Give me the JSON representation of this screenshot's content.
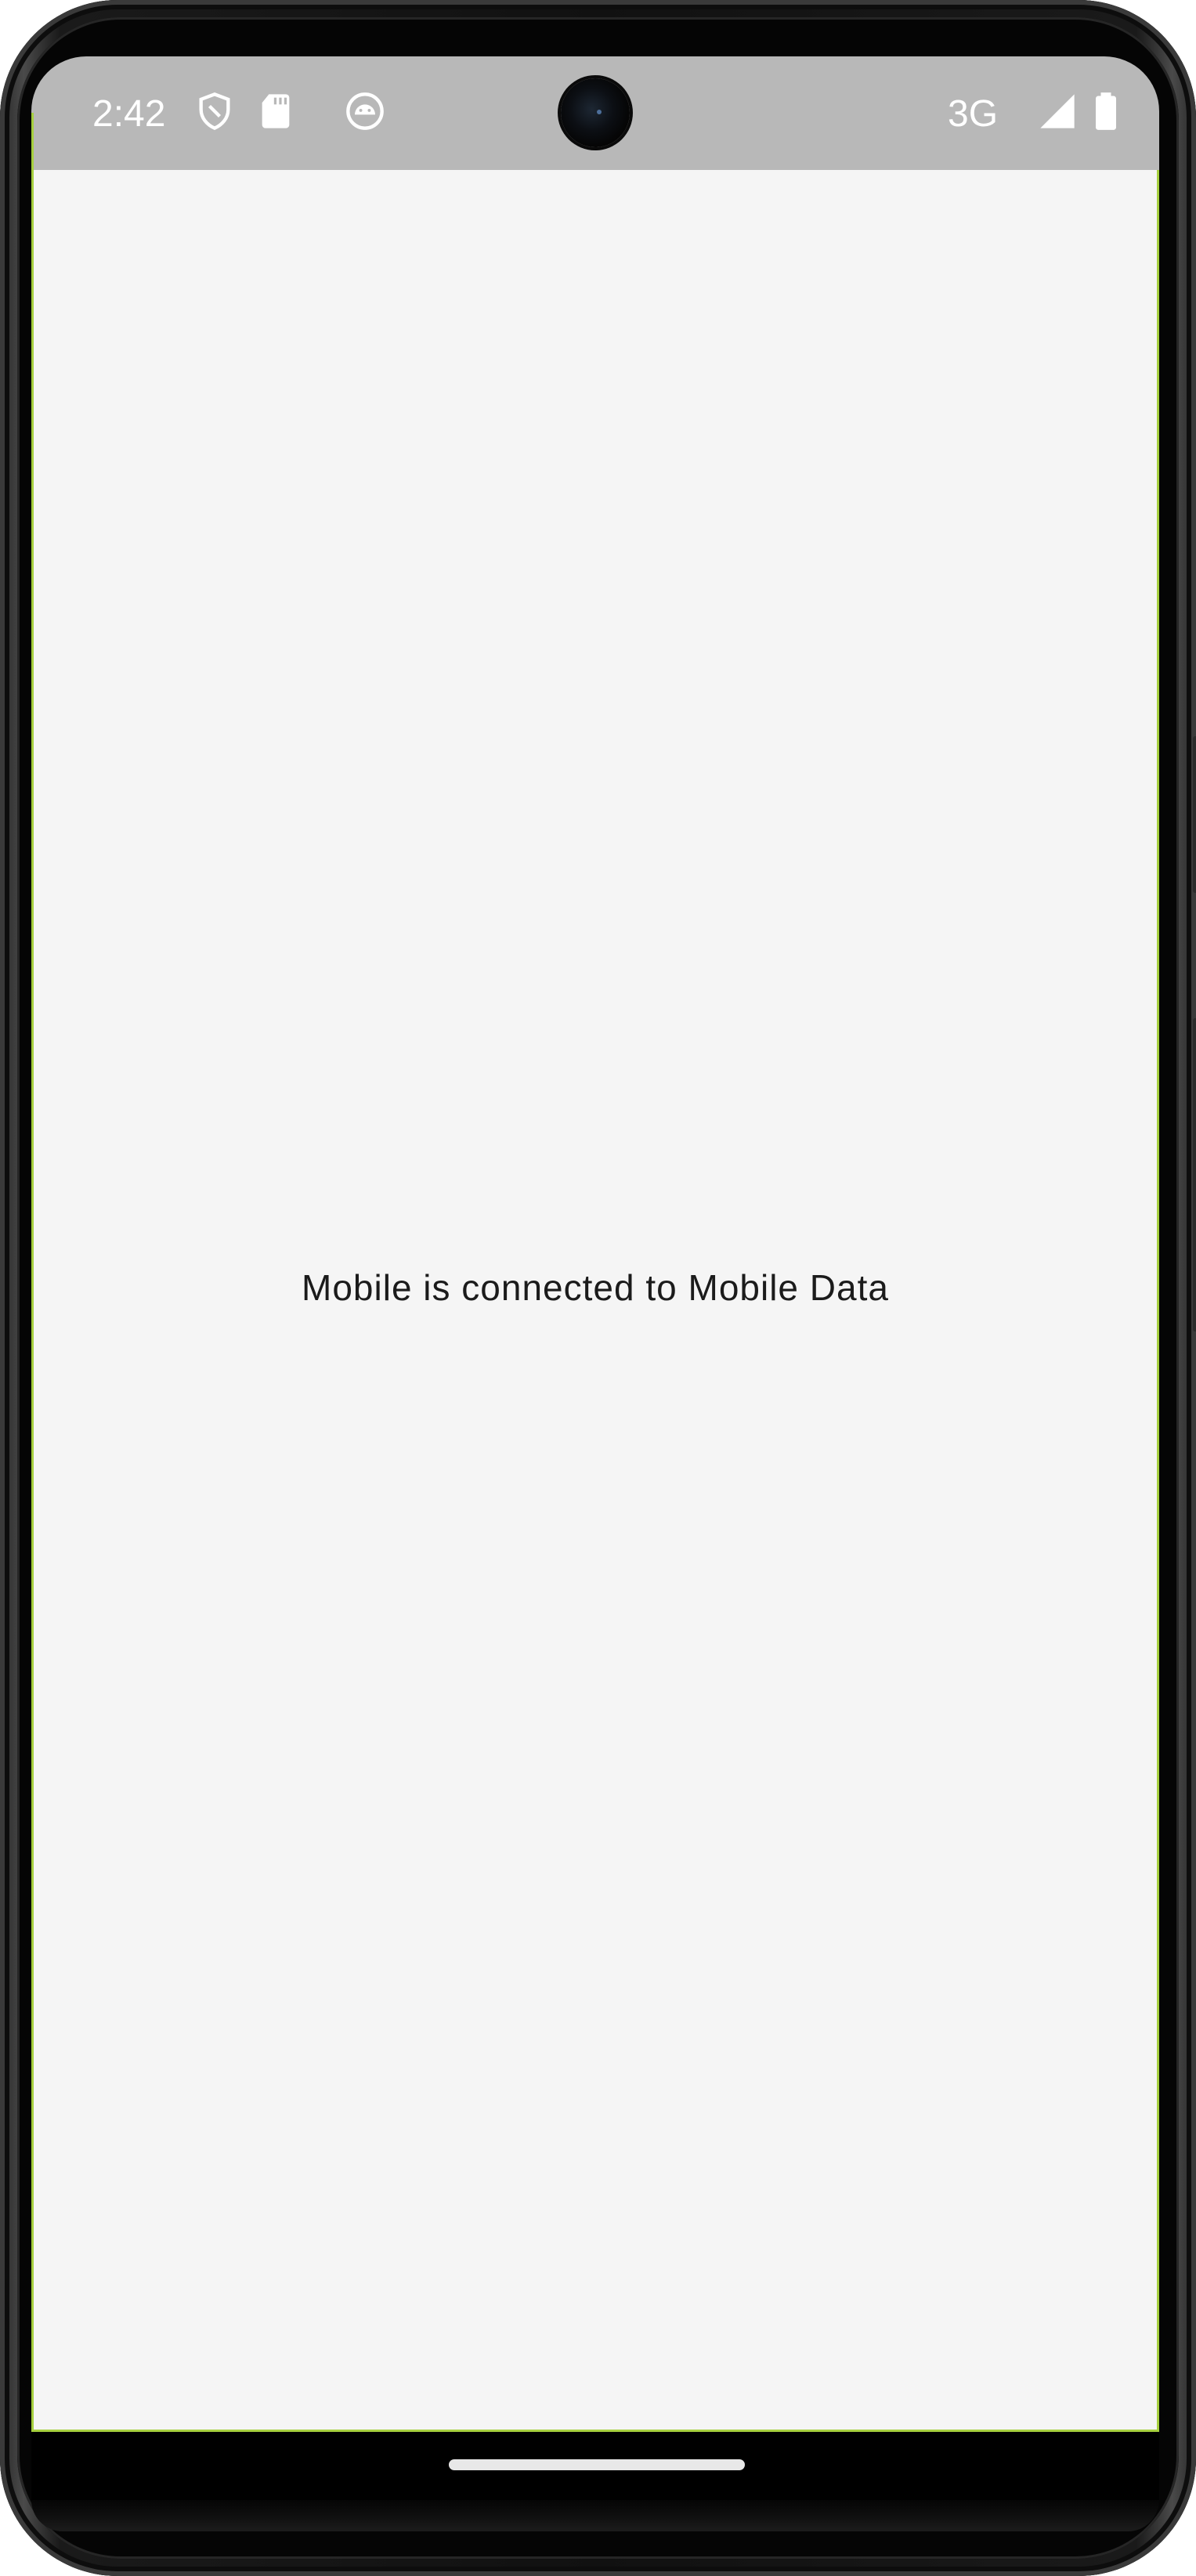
{
  "status_bar": {
    "time": "2:42",
    "network": "3G",
    "icons": [
      "shield-icon",
      "sd-card-icon",
      "android-debug-icon",
      "signal-icon",
      "battery-icon"
    ],
    "background": "#b8b8b8"
  },
  "main": {
    "message": "Mobile is connected to Mobile Data",
    "background": "#f5f5f5",
    "accent_border": "#a6cf3f"
  },
  "navigation": {
    "home_indicator": "home-indicator"
  }
}
